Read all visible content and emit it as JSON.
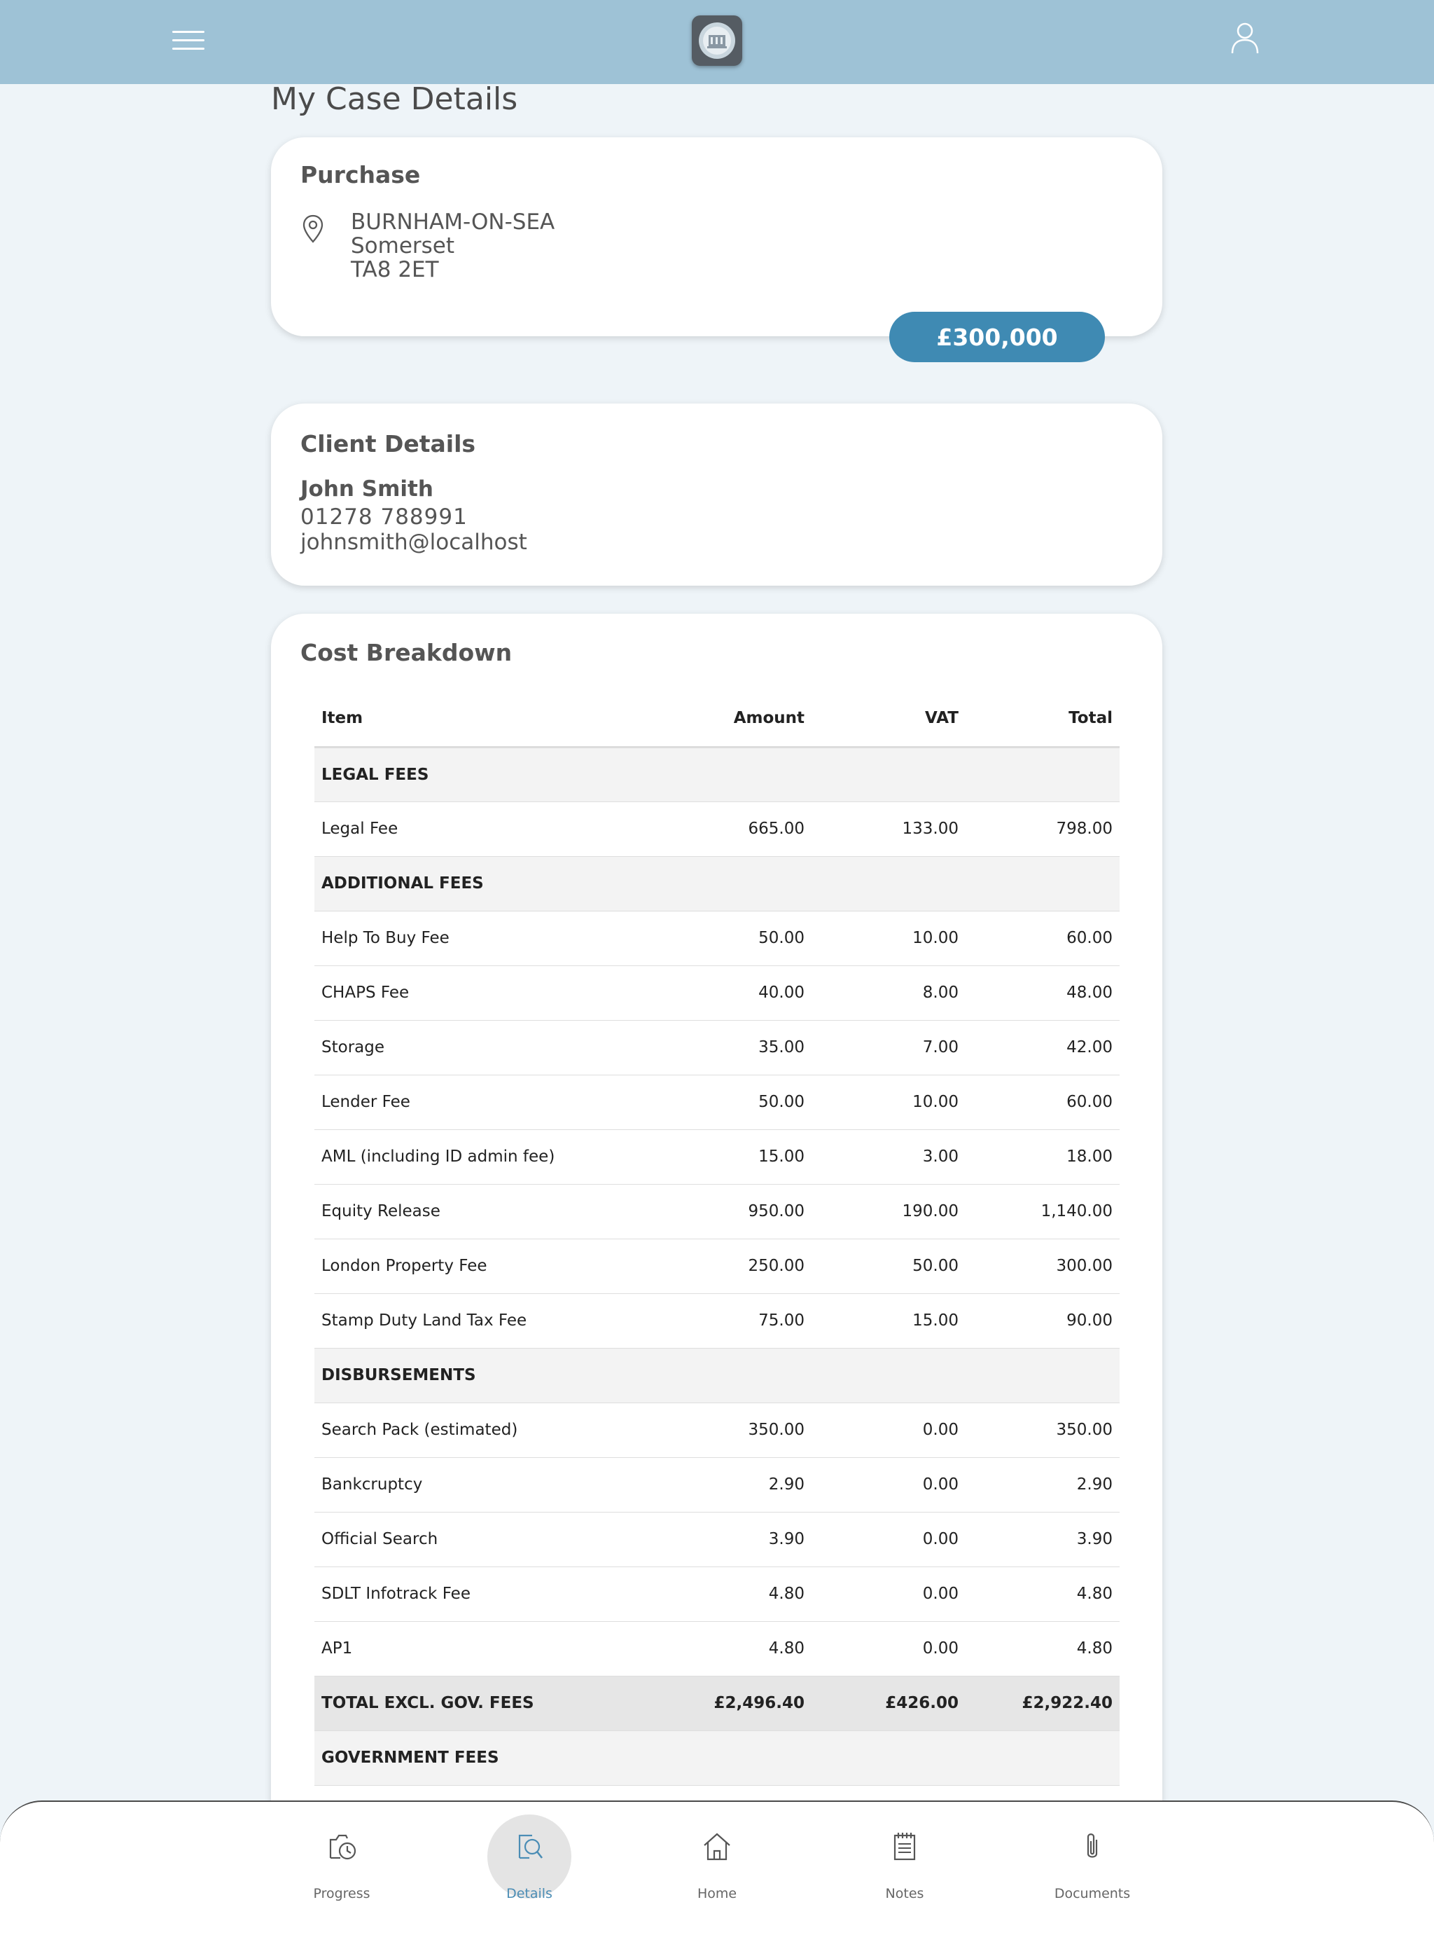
{
  "header": {
    "menu_icon": "hamburger-menu-icon",
    "logo": "brand-logo",
    "user_icon": "user-profile-icon"
  },
  "page": {
    "title": "My Case Details"
  },
  "purchase": {
    "title": "Purchase",
    "location_icon": "location-pin-icon",
    "address": [
      "BURNHAM-ON-SEA",
      "Somerset",
      "TA8 2ET"
    ],
    "price": "£300,000"
  },
  "client": {
    "title": "Client Details",
    "name": "John Smith",
    "phone": "01278 788991",
    "email": "johnsmith@localhost"
  },
  "costs": {
    "title": "Cost Breakdown",
    "headers": {
      "item": "Item",
      "amount": "Amount",
      "vat": "VAT",
      "total": "Total"
    },
    "sections": [
      {
        "heading": "LEGAL FEES",
        "rows": [
          {
            "item": "Legal Fee",
            "amount": "665.00",
            "vat": "133.00",
            "total": "798.00"
          }
        ]
      },
      {
        "heading": "ADDITIONAL FEES",
        "rows": [
          {
            "item": "Help To Buy Fee",
            "amount": "50.00",
            "vat": "10.00",
            "total": "60.00"
          },
          {
            "item": "CHAPS Fee",
            "amount": "40.00",
            "vat": "8.00",
            "total": "48.00"
          },
          {
            "item": "Storage",
            "amount": "35.00",
            "vat": "7.00",
            "total": "42.00"
          },
          {
            "item": "Lender Fee",
            "amount": "50.00",
            "vat": "10.00",
            "total": "60.00"
          },
          {
            "item": "AML (including ID admin fee)",
            "amount": "15.00",
            "vat": "3.00",
            "total": "18.00"
          },
          {
            "item": "Equity Release",
            "amount": "950.00",
            "vat": "190.00",
            "total": "1,140.00"
          },
          {
            "item": "London Property Fee",
            "amount": "250.00",
            "vat": "50.00",
            "total": "300.00"
          },
          {
            "item": "Stamp Duty Land Tax Fee",
            "amount": "75.00",
            "vat": "15.00",
            "total": "90.00"
          }
        ]
      },
      {
        "heading": "DISBURSEMENTS",
        "rows": [
          {
            "item": "Search Pack (estimated)",
            "amount": "350.00",
            "vat": "0.00",
            "total": "350.00"
          },
          {
            "item": "Bankcruptcy",
            "amount": "2.90",
            "vat": "0.00",
            "total": "2.90"
          },
          {
            "item": "Official Search",
            "amount": "3.90",
            "vat": "0.00",
            "total": "3.90"
          },
          {
            "item": "SDLT Infotrack Fee",
            "amount": "4.80",
            "vat": "0.00",
            "total": "4.80"
          },
          {
            "item": "AP1",
            "amount": "4.80",
            "vat": "0.00",
            "total": "4.80"
          }
        ]
      }
    ],
    "total_row": {
      "item": "TOTAL EXCL. GOV. FEES",
      "amount": "£2,496.40",
      "vat": "£426.00",
      "total": "£2,922.40"
    },
    "gov_heading": "GOVERNMENT FEES"
  },
  "nav": {
    "active": "Details",
    "items": [
      {
        "id": "progress",
        "label": "Progress",
        "icon": "progress-clock-icon"
      },
      {
        "id": "details",
        "label": "Details",
        "icon": "document-search-icon"
      },
      {
        "id": "home",
        "label": "Home",
        "icon": "home-icon"
      },
      {
        "id": "notes",
        "label": "Notes",
        "icon": "notepad-icon"
      },
      {
        "id": "documents",
        "label": "Documents",
        "icon": "paperclip-icon"
      }
    ]
  },
  "colors": {
    "header_bg": "#9ec2d6",
    "page_bg": "#eef4f8",
    "accent": "#3f8ab3",
    "active_nav_text": "#4b8db5"
  }
}
